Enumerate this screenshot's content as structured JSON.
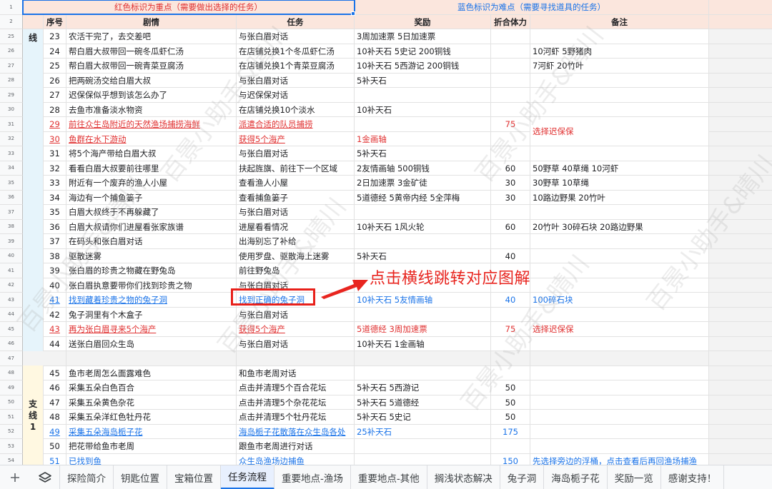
{
  "header": {
    "red_note": "红色标识为重点（需要做出选择的任务）",
    "blue_note": "蓝色标识为难点（需要寻找道具的任务）",
    "row_num_top": "1",
    "row_num_sub": "2",
    "columns": {
      "seq": "序号",
      "story": "剧情",
      "task": "任务",
      "reward": "奖励",
      "stamina": "折合体力",
      "note": "备注"
    }
  },
  "sections": {
    "main_line": "线",
    "side_line": "支线1"
  },
  "rows": [
    {
      "rn": "25",
      "seq": "23",
      "story": "农活干完了，去交差吧",
      "task": "与张白眉对话",
      "reward": "3周加速票  5日加速票",
      "stamina": "",
      "note": "",
      "style": ""
    },
    {
      "rn": "26",
      "seq": "24",
      "story": "帮白眉大叔带回一碗冬瓜虾仁汤",
      "task": "在店铺兑换1个冬瓜虾仁汤",
      "reward": "10补天石  5史记  200铜钱",
      "stamina": "",
      "note": "10河虾  5野猪肉",
      "style": ""
    },
    {
      "rn": "27",
      "seq": "25",
      "story": "帮白眉大叔带回一碗青菜豆腐汤",
      "task": "在店铺兑换1个青菜豆腐汤",
      "reward": "10补天石  5西游记  200铜钱",
      "stamina": "",
      "note": "7河虾  20竹叶",
      "style": ""
    },
    {
      "rn": "28",
      "seq": "26",
      "story": "把两碗汤交给白眉大叔",
      "task": "与张白眉对话",
      "reward": "5补天石",
      "stamina": "",
      "note": "",
      "style": ""
    },
    {
      "rn": "29",
      "seq": "27",
      "story": "迟保保似乎想到该怎么办了",
      "task": "与迟保保对话",
      "reward": "",
      "stamina": "",
      "note": "",
      "style": ""
    },
    {
      "rn": "30",
      "seq": "28",
      "story": "去鱼市准备淡水物资",
      "task": "在店铺兑换10个淡水",
      "reward": "10补天石",
      "stamina": "",
      "note": "",
      "style": ""
    },
    {
      "rn": "31",
      "seq": "29",
      "story": "前往众生岛附近的天然渔场捕捞海鲜",
      "task": "派遣合适的队员捕捞",
      "reward": "",
      "stamina": "75",
      "note": "",
      "style": "red"
    },
    {
      "rn": "32",
      "seq": "30",
      "story": "鱼群在水下游动",
      "task": "获得5个海产",
      "reward": "1金画轴",
      "stamina": "",
      "note": "",
      "style": "red"
    },
    {
      "rn": "33",
      "seq": "31",
      "story": "将5个海产带给白眉大叔",
      "task": "与张白眉对话",
      "reward": "5补天石",
      "stamina": "",
      "note": "",
      "style": ""
    },
    {
      "rn": "34",
      "seq": "32",
      "story": "看看白眉大叔要前往哪里",
      "task": "扶起旌旗、前往下一个区域",
      "reward": "2友情画轴  500铜钱",
      "stamina": "60",
      "note": "50野草  40草绳  10河虾",
      "style": ""
    },
    {
      "rn": "35",
      "seq": "33",
      "story": "附近有一个废弃的渔人小屋",
      "task": "查看渔人小屋",
      "reward": "2日加速票  3金矿徒",
      "stamina": "30",
      "note": "30野草  10草绳",
      "style": ""
    },
    {
      "rn": "36",
      "seq": "34",
      "story": "海边有一个捕鱼篓子",
      "task": "查看捕鱼篓子",
      "reward": "5道德经  5黄帝内经  5全萍梅",
      "stamina": "30",
      "note": "10路边野果  20竹叶",
      "style": ""
    },
    {
      "rn": "37",
      "seq": "35",
      "story": "白眉大叔终于不再躲藏了",
      "task": "与张白眉对话",
      "reward": "",
      "stamina": "",
      "note": "",
      "style": ""
    },
    {
      "rn": "38",
      "seq": "36",
      "story": "白眉大叔请你们进屋看张家族谱",
      "task": "进屋看看情况",
      "reward": "10补天石  1风火轮",
      "stamina": "60",
      "note": "20竹叶  30碎石块  20路边野果",
      "style": ""
    },
    {
      "rn": "39",
      "seq": "37",
      "story": "在码头和张白眉对话",
      "task": "出海别忘了补给",
      "reward": "",
      "stamina": "",
      "note": "",
      "style": ""
    },
    {
      "rn": "40",
      "seq": "38",
      "story": "驱散迷雾",
      "task": "使用罗盘、驱散海上迷雾",
      "reward": "5补天石",
      "stamina": "40",
      "note": "",
      "style": ""
    },
    {
      "rn": "41",
      "seq": "39",
      "story": "张白眉的珍贵之物藏在野兔岛",
      "task": "前往野兔岛",
      "reward": "",
      "stamina": "",
      "note": "",
      "style": ""
    },
    {
      "rn": "42",
      "seq": "40",
      "story": "张白眉执意要带你们找到珍贵之物",
      "task": "与张白眉对话",
      "reward": "",
      "stamina": "",
      "note": "",
      "style": ""
    },
    {
      "rn": "43",
      "seq": "41",
      "story": "找到藏着珍贵之物的兔子洞",
      "task": "找到正确的兔子洞",
      "reward": "10补天石  5友情画轴",
      "stamina": "40",
      "note": "100碎石块",
      "style": "blue"
    },
    {
      "rn": "44",
      "seq": "42",
      "story": "兔子洞里有个木盒子",
      "task": "与张白眉对话",
      "reward": "",
      "stamina": "",
      "note": "",
      "style": ""
    },
    {
      "rn": "45",
      "seq": "43",
      "story": "再为张白眉寻来5个海产",
      "task": "获得5个海产",
      "reward": "5道德经  3周加速票",
      "stamina": "75",
      "note": "选择迟保保",
      "style": "red"
    },
    {
      "rn": "46",
      "seq": "44",
      "story": "送张白眉回众生岛",
      "task": "与张白眉对话",
      "reward": "10补天石  1金画轴",
      "stamina": "",
      "note": "",
      "style": ""
    },
    {
      "rn": "47",
      "seq": "",
      "story": "",
      "task": "",
      "reward": "",
      "stamina": "",
      "note": "",
      "style": "gap"
    },
    {
      "rn": "48",
      "seq": "45",
      "story": "鱼市老周怎么面露难色",
      "task": "和鱼市老周对话",
      "reward": "",
      "stamina": "",
      "note": "",
      "style": ""
    },
    {
      "rn": "49",
      "seq": "46",
      "story": "采集五朵白色百合",
      "task": "点击并清理5个百合花坛",
      "reward": "5补天石  5西游记",
      "stamina": "50",
      "note": "",
      "style": ""
    },
    {
      "rn": "50",
      "seq": "47",
      "story": "采集五朵黄色杂花",
      "task": "点击并清理5个杂花花坛",
      "reward": "5补天石  5道德经",
      "stamina": "50",
      "note": "",
      "style": ""
    },
    {
      "rn": "51",
      "seq": "48",
      "story": "采集五朵洋红色牡丹花",
      "task": "点击并清理5个牡丹花坛",
      "reward": "5补天石  5史记",
      "stamina": "50",
      "note": "",
      "style": ""
    },
    {
      "rn": "52",
      "seq": "49",
      "story": "采集五朵海岛栀子花",
      "task": "海岛栀子花散落在众生岛各处",
      "reward": "25补天石",
      "stamina": "175",
      "note": "",
      "style": "blue"
    },
    {
      "rn": "53",
      "seq": "50",
      "story": "把花带给鱼市老周",
      "task": "跟鱼市老周进行对话",
      "reward": "",
      "stamina": "",
      "note": "",
      "style": ""
    },
    {
      "rn": "54",
      "seq": "51",
      "story": "已找到鱼",
      "task": "众生岛渔场边捕鱼",
      "reward": "",
      "stamina": "150",
      "note": "先选择旁边的浮桶，点击查看后再回渔场捕渔",
      "style": "blue"
    }
  ],
  "merged_notes": {
    "choose_chibaobao": "选择迟保保"
  },
  "annotation": {
    "text": "点击横线跳转对应图解"
  },
  "watermark": "百景小助手&晴川",
  "tabs": [
    {
      "label": "探险简介"
    },
    {
      "label": "钥匙位置"
    },
    {
      "label": "宝箱位置"
    },
    {
      "label": "任务流程"
    },
    {
      "label": "重要地点-渔场"
    },
    {
      "label": "重要地点-其他"
    },
    {
      "label": "搁浅状态解决"
    },
    {
      "label": "兔子洞"
    },
    {
      "label": "海岛栀子花"
    },
    {
      "label": "奖励一览"
    },
    {
      "label": "感谢支持！"
    }
  ],
  "active_tab": "任务流程",
  "icons": {
    "add": "plus-icon",
    "sheets": "layers-icon"
  }
}
